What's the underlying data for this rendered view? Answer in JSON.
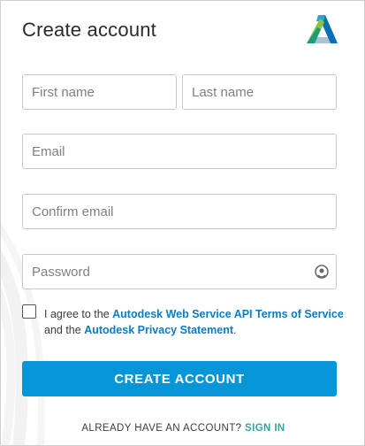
{
  "header": {
    "title": "Create account"
  },
  "logo": {
    "icon": "autodesk-logo-icon"
  },
  "form": {
    "first_name_placeholder": "First name",
    "last_name_placeholder": "Last name",
    "email_placeholder": "Email",
    "confirm_email_placeholder": "Confirm email",
    "password_placeholder": "Password",
    "password_toggle_icon": "eye-icon"
  },
  "terms": {
    "checked": false,
    "prefix": "I agree to the ",
    "link1": "Autodesk Web Service API Terms of Service",
    "middle": " and the ",
    "link2": "Autodesk Privacy Statement",
    "suffix": "."
  },
  "submit": {
    "label": "CREATE ACCOUNT"
  },
  "footer": {
    "prompt": "ALREADY HAVE AN ACCOUNT? ",
    "signin_label": "SIGN IN"
  },
  "colors": {
    "primary": "#0696d7",
    "link": "#0a7cbf",
    "signin": "#2fa8a0"
  }
}
